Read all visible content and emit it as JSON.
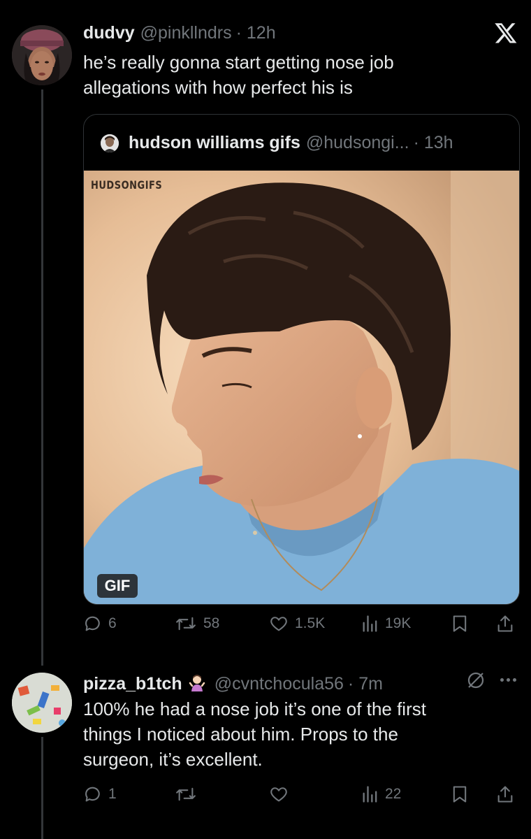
{
  "tweet": {
    "display_name": "dudvy",
    "handle": "@pinkllndrs",
    "time": "· 12h",
    "text_line1": "he’s really gonna start getting nose job",
    "text_line2": "allegations with how perfect his is",
    "avatar_icon": "user-avatar",
    "quote": {
      "display_name": "hudson williams gifs",
      "handle": "@hudsongi...",
      "time": "· 13h",
      "watermark": "HUDSONGIFS",
      "media_badge": "GIF"
    },
    "actions": {
      "replies": "6",
      "reposts": "58",
      "likes": "1.5K",
      "views": "19K"
    }
  },
  "reply": {
    "display_name": "pizza_b1tch",
    "name_emoji_icon": "person-shrugging-emoji",
    "handle": "@cvntchocula56",
    "time": "· 7m",
    "text_line1": "100% he had a nose job it’s one of the first",
    "text_line2": "things I noticed about him. Props to the",
    "text_line3": "surgeon, it’s excellent.",
    "actions": {
      "replies": "1",
      "reposts": "",
      "likes": "",
      "views": "22"
    }
  },
  "colors": {
    "background": "#000000",
    "text_primary": "#e7e9ea",
    "text_secondary": "#71767b",
    "border": "#2f3336"
  }
}
